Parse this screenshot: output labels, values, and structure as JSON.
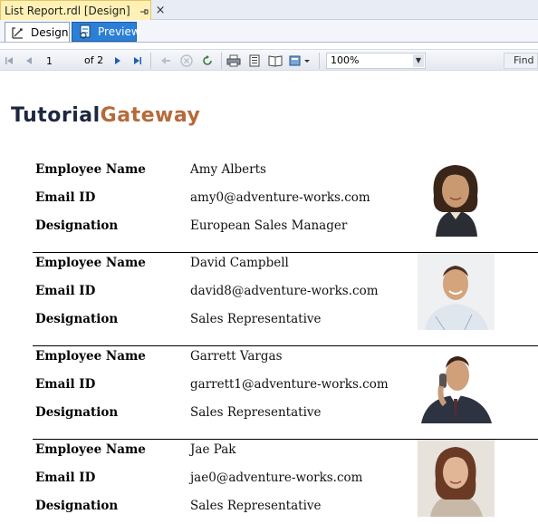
{
  "document_tab": {
    "title": "List Report.rdl [Design]"
  },
  "view_tabs": [
    {
      "label": "Design"
    },
    {
      "label": "Preview"
    }
  ],
  "toolbar": {
    "page": "1",
    "of_label": "of",
    "total_pages": "2",
    "zoom": "100%",
    "find": "Find"
  },
  "report": {
    "logo_part1": "Tutorial",
    "logo_part2": "Gateway",
    "field_labels": {
      "name": "Employee Name",
      "email": "Email ID",
      "designation": "Designation"
    },
    "employees": [
      {
        "name": "Amy Alberts",
        "email": "amy0@adventure-works.com",
        "designation": "European Sales Manager"
      },
      {
        "name": "David Campbell",
        "email": "david8@adventure-works.com",
        "designation": "Sales Representative"
      },
      {
        "name": "Garrett Vargas",
        "email": "garrett1@adventure-works.com",
        "designation": "Sales Representative"
      },
      {
        "name": "Jae Pak",
        "email": "jae0@adventure-works.com",
        "designation": "Sales Representative"
      }
    ]
  },
  "colors": {
    "logo_dark": "#1d2740",
    "logo_accent": "#b66a3a",
    "preview_tab": "#2b7fd6",
    "doc_tab": "#fff1b6"
  }
}
